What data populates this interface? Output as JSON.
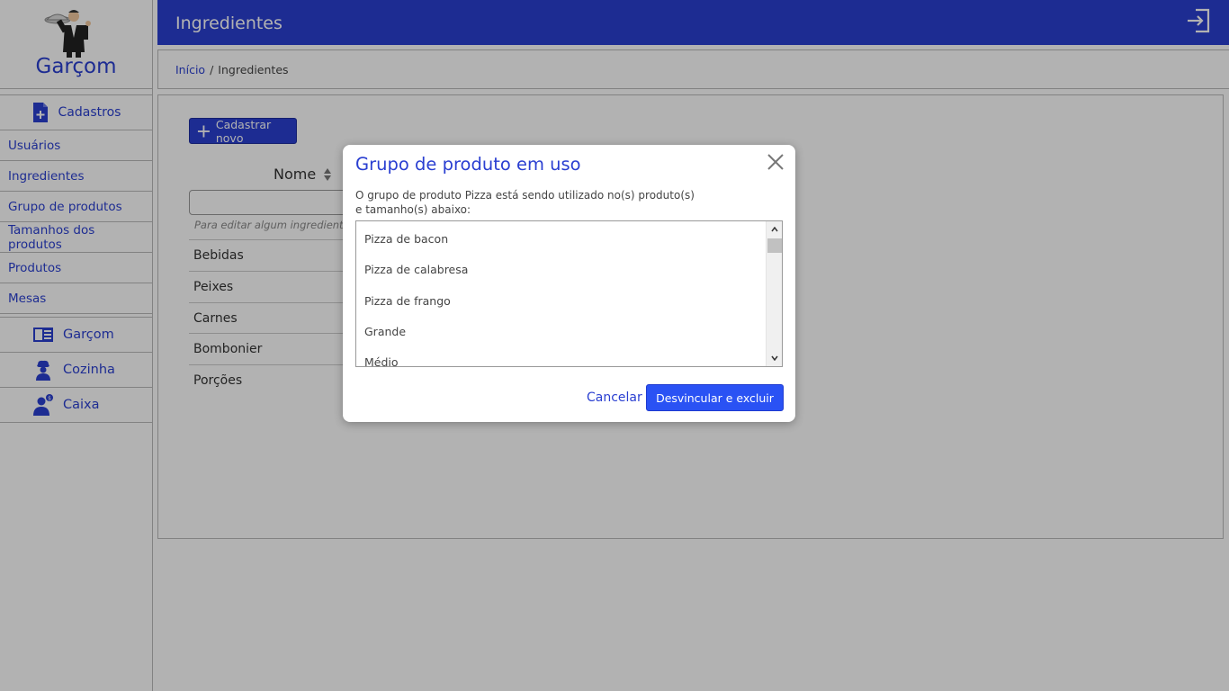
{
  "app": {
    "brand": "Garçom"
  },
  "sidebar": {
    "section_label": "Cadastros",
    "items": [
      {
        "label": "Usuários"
      },
      {
        "label": "Ingredientes"
      },
      {
        "label": "Grupo de produtos"
      },
      {
        "label": "Tamanhos dos produtos"
      },
      {
        "label": "Produtos"
      },
      {
        "label": "Mesas"
      }
    ],
    "modules": [
      {
        "label": "Garçom",
        "icon": "menu-book-icon"
      },
      {
        "label": "Cozinha",
        "icon": "chef-icon"
      },
      {
        "label": "Caixa",
        "icon": "cashier-icon"
      }
    ]
  },
  "header": {
    "title": "Ingredientes",
    "logout_icon": "logout-icon"
  },
  "breadcrumb": {
    "home": "Início",
    "separator": "/",
    "current": "Ingredientes"
  },
  "main": {
    "new_button": "Cadastrar novo",
    "column_header": "Nome",
    "hint": "Para editar algum ingrediente",
    "rows": [
      "Bebidas",
      "Peixes",
      "Carnes",
      "Bombonier",
      "Porções"
    ]
  },
  "modal": {
    "title": "Grupo de produto em uso",
    "message_line1": "O grupo de produto Pizza está sendo utilizado no(s) produto(s)",
    "message_line2": "e tamanho(s) abaixo:",
    "items": [
      "Pizza de bacon",
      "Pizza de calabresa",
      "Pizza de frango",
      "Grande",
      "Médio"
    ],
    "cancel_label": "Cancelar",
    "confirm_label": "Desvincular e excluir"
  },
  "colors": {
    "primary": "#2a3fd1",
    "button": "#2a52f4"
  }
}
